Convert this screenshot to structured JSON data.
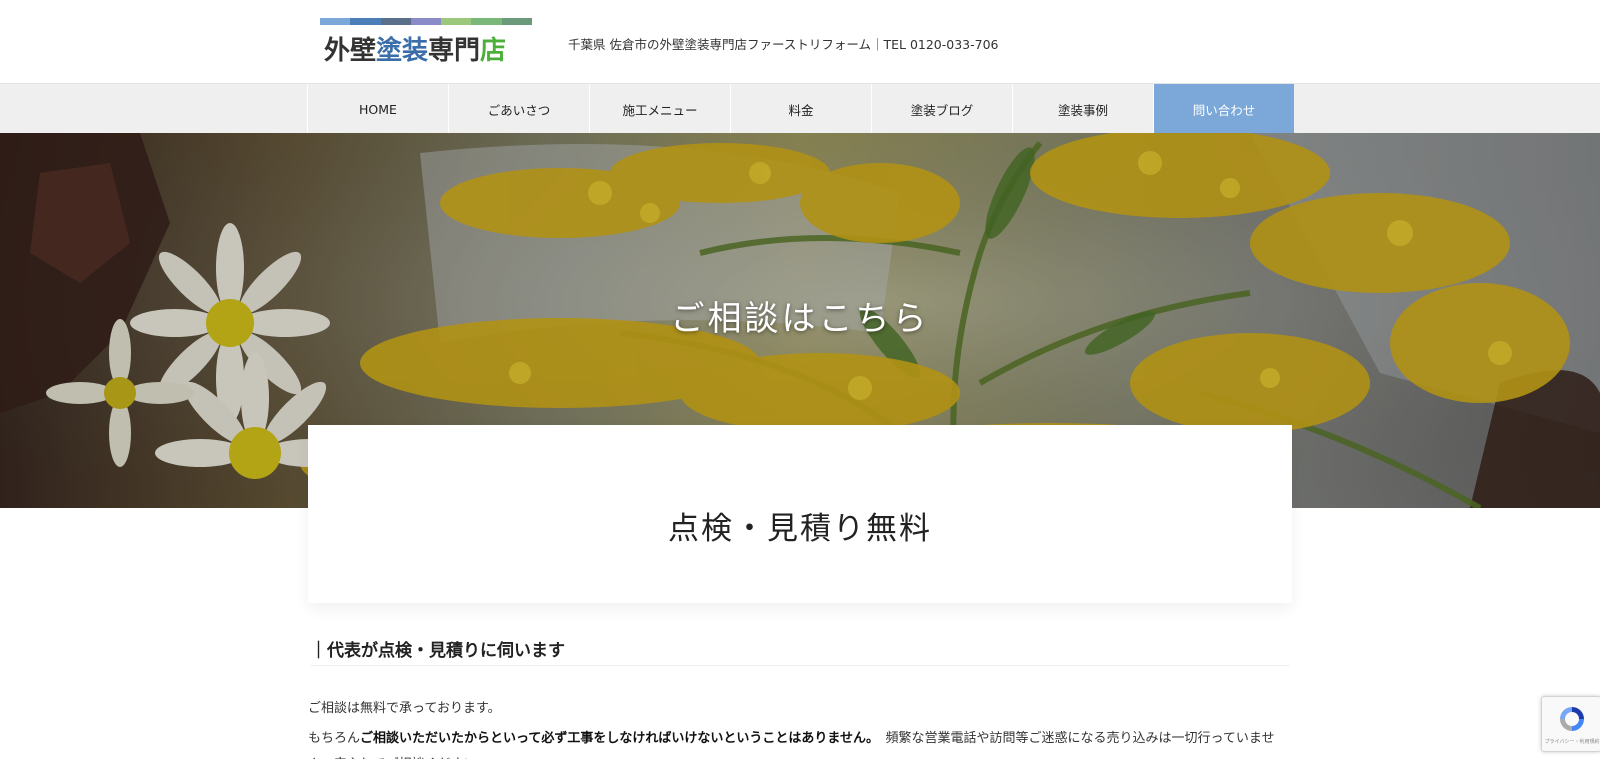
{
  "header": {
    "logo": {
      "part1": "外壁",
      "part2": "塗装",
      "part3": "専門",
      "part4": "店",
      "colors": {
        "part1": "#333333",
        "part2": "#3b6ea8",
        "part3": "#333333",
        "part4": "#4caf3a"
      },
      "bar_colors": [
        "#7ba8d8",
        "#4a7fb8",
        "#5a6f8a",
        "#8a8ac8",
        "#9bc87a",
        "#7ab87a",
        "#6a9a7a"
      ]
    },
    "tagline": "千葉県 佐倉市の外壁塗装専門店ファーストリフォーム｜TEL 0120-033-706"
  },
  "nav": {
    "items": [
      {
        "label": "HOME",
        "active": false
      },
      {
        "label": "ごあいさつ",
        "active": false
      },
      {
        "label": "施工メニュー",
        "active": false
      },
      {
        "label": "料金",
        "active": false
      },
      {
        "label": "塗装ブログ",
        "active": false
      },
      {
        "label": "塗装事例",
        "active": false
      },
      {
        "label": "問い合わせ",
        "active": true
      }
    ],
    "active_color": "#7ba8d8"
  },
  "hero": {
    "title": "ご相談はこちら"
  },
  "card": {
    "title": "点検・見積り無料"
  },
  "content": {
    "heading": "｜代表が点検・見積りに伺います",
    "para1": "ご相談は無料で承っております。",
    "para2_pre": "もちろん",
    "para2_bold": "ご相談いただいたからといって必ず工事をしなければいけないということはありません。",
    "para2_post": "　頻繁な営業電話や訪問等ご迷惑になる売り込みは一切行っていません。安心してご相談ください。"
  },
  "recaptcha": {
    "text": "プライバシー・利用規約"
  }
}
